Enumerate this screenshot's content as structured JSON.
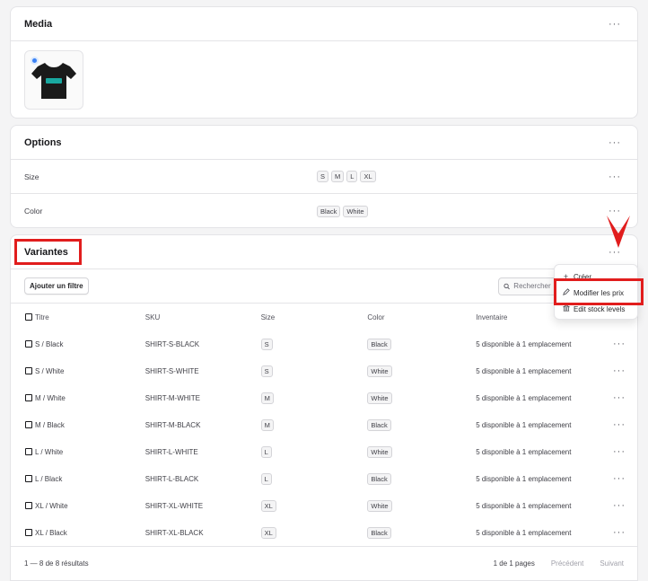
{
  "media": {
    "title": "Media",
    "more_icon": "more-horizontal-icon"
  },
  "options": {
    "title": "Options",
    "rows": [
      {
        "label": "Size",
        "values": [
          "S",
          "M",
          "L",
          "XL"
        ]
      },
      {
        "label": "Color",
        "values": [
          "Black",
          "White"
        ]
      }
    ]
  },
  "variants": {
    "title": "Variantes",
    "add_filter": "Ajouter un filtre",
    "search_placeholder": "Rechercher",
    "columns": [
      "Titre",
      "SKU",
      "Size",
      "Color",
      "Inventaire"
    ],
    "rows": [
      {
        "title": "S / Black",
        "sku": "SHIRT-S-BLACK",
        "size": "S",
        "color": "Black",
        "inventory": "5 disponible à 1 emplacement"
      },
      {
        "title": "S / White",
        "sku": "SHIRT-S-WHITE",
        "size": "S",
        "color": "White",
        "inventory": "5 disponible à 1 emplacement"
      },
      {
        "title": "M / White",
        "sku": "SHIRT-M-WHITE",
        "size": "M",
        "color": "White",
        "inventory": "5 disponible à 1 emplacement"
      },
      {
        "title": "M / Black",
        "sku": "SHIRT-M-BLACK",
        "size": "M",
        "color": "Black",
        "inventory": "5 disponible à 1 emplacement"
      },
      {
        "title": "L / White",
        "sku": "SHIRT-L-WHITE",
        "size": "L",
        "color": "White",
        "inventory": "5 disponible à 1 emplacement"
      },
      {
        "title": "L / Black",
        "sku": "SHIRT-L-BLACK",
        "size": "L",
        "color": "Black",
        "inventory": "5 disponible à 1 emplacement"
      },
      {
        "title": "XL / White",
        "sku": "SHIRT-XL-WHITE",
        "size": "XL",
        "color": "White",
        "inventory": "5 disponible à 1 emplacement"
      },
      {
        "title": "XL / Black",
        "sku": "SHIRT-XL-BLACK",
        "size": "XL",
        "color": "Black",
        "inventory": "5 disponible à 1 emplacement"
      }
    ],
    "pagination": {
      "results": "1 — 8 de 8 résultats",
      "pages": "1 de 1 pages",
      "prev": "Précédent",
      "next": "Suivant"
    }
  },
  "menu": {
    "items": [
      {
        "label": "Créer",
        "icon": "plus-icon"
      },
      {
        "label": "Modifier les prix",
        "icon": "pencil-icon"
      },
      {
        "label": "Edit stock levels",
        "icon": "building-icon"
      }
    ]
  },
  "colors": {
    "highlight": "#e11d1d",
    "accent": "#3b82f6",
    "border": "#e4e4e7"
  }
}
